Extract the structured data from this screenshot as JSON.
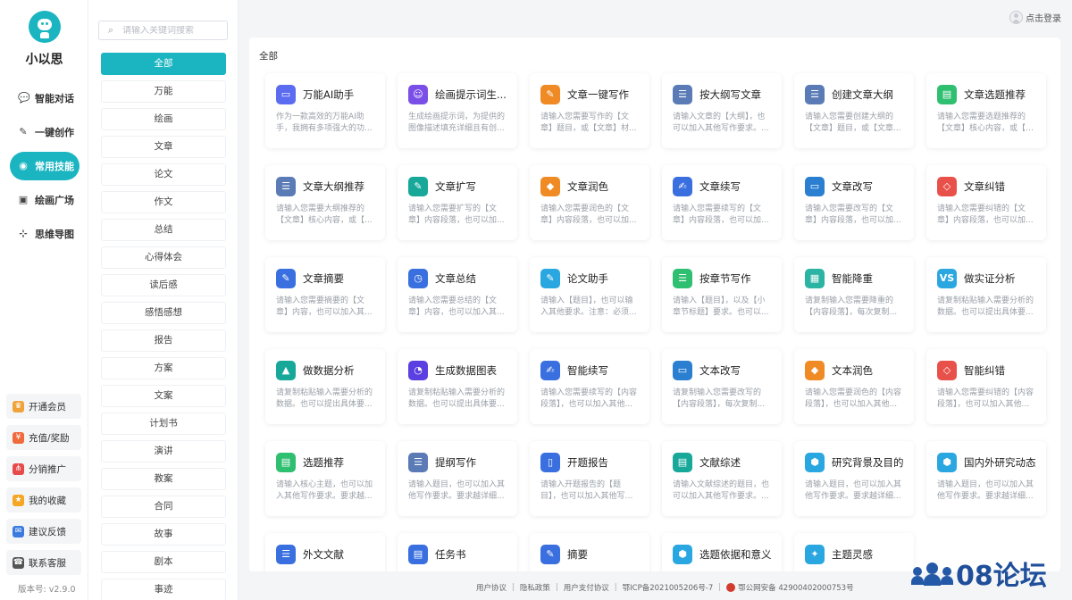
{
  "brand": {
    "name": "小以思"
  },
  "nav": [
    {
      "label": "智能对话",
      "icon": "chat-icon",
      "glyph": "💬",
      "active": false
    },
    {
      "label": "一键创作",
      "icon": "pen-icon",
      "glyph": "✎",
      "active": false
    },
    {
      "label": "常用技能",
      "icon": "skills-icon",
      "glyph": "◉",
      "active": true
    },
    {
      "label": "绘画广场",
      "icon": "image-icon",
      "glyph": "▣",
      "active": false
    },
    {
      "label": "思维导图",
      "icon": "mindmap-icon",
      "glyph": "⊹",
      "active": false
    }
  ],
  "bottom_menu": [
    {
      "label": "开通会员",
      "icon": "vip-icon",
      "glyph": "♛",
      "color": "#f0a23b"
    },
    {
      "label": "充值/奖励",
      "icon": "recharge-icon",
      "glyph": "¥",
      "color": "#f06a3b"
    },
    {
      "label": "分销推广",
      "icon": "share-icon",
      "glyph": "⋔",
      "color": "#e64a4a"
    },
    {
      "label": "我的收藏",
      "icon": "star-icon",
      "glyph": "★",
      "color": "#f5a623"
    },
    {
      "label": "建议反馈",
      "icon": "feedback-icon",
      "glyph": "✉",
      "color": "#3a7be0"
    },
    {
      "label": "联系客服",
      "icon": "service-icon",
      "glyph": "☎",
      "color": "#555555"
    }
  ],
  "version": "版本号: v2.9.0",
  "search": {
    "placeholder": "请输入关键词搜索"
  },
  "categories": [
    {
      "label": "全部",
      "active": true
    },
    {
      "label": "万能"
    },
    {
      "label": "绘画"
    },
    {
      "label": "文章"
    },
    {
      "label": "论文"
    },
    {
      "label": "作文"
    },
    {
      "label": "总结"
    },
    {
      "label": "心得体会"
    },
    {
      "label": "读后感"
    },
    {
      "label": "感悟感想"
    },
    {
      "label": "报告"
    },
    {
      "label": "方案"
    },
    {
      "label": "文案"
    },
    {
      "label": "计划书"
    },
    {
      "label": "演讲"
    },
    {
      "label": "教案"
    },
    {
      "label": "合同"
    },
    {
      "label": "故事"
    },
    {
      "label": "剧本"
    },
    {
      "label": "事迹"
    }
  ],
  "header": {
    "login_label": "点击登录"
  },
  "main": {
    "section_title": "全部"
  },
  "cards": [
    {
      "title": "万能AI助手",
      "desc": "作为一款高效的万能AI助手，我拥有多项强大的功...",
      "icon": "ai-assistant-icon",
      "glyph": "▭",
      "color": "#5b6cf0"
    },
    {
      "title": "绘画提示词生...",
      "desc": "生成绘画提示词，为提供的图像描述填充详细且有创...",
      "icon": "robot-icon",
      "glyph": "☺",
      "color": "#7a4fe8"
    },
    {
      "title": "文章一键写作",
      "desc": "请输入您需要写作的【文章】题目，或【文章】材...",
      "icon": "pencil-icon",
      "glyph": "✎",
      "color": "#f08a24"
    },
    {
      "title": "按大纲写文章",
      "desc": "请输入文章的【大纲】，也可以加入其他写作要求。...",
      "icon": "outline-icon",
      "glyph": "☰",
      "color": "#5a7bb5"
    },
    {
      "title": "创建文章大纲",
      "desc": "请输入您需要创建大纲的【文章】题目，或【文章...",
      "icon": "outline-icon",
      "glyph": "☰",
      "color": "#5a7bb5"
    },
    {
      "title": "文章选题推荐",
      "desc": "请输入您需要选题推荐的【文章】核心内容，或【文章...",
      "icon": "topic-icon",
      "glyph": "▤",
      "color": "#2fbf71"
    },
    {
      "title": "文章大纲推荐",
      "desc": "请输入您需要大纲推荐的【文章】核心内容，或【...",
      "icon": "outline-icon",
      "glyph": "☰",
      "color": "#5a7bb5"
    },
    {
      "title": "文章扩写",
      "desc": "请输入您需要扩写的【文章】内容段落，也可以加...",
      "icon": "expand-icon",
      "glyph": "✎",
      "color": "#17a89a"
    },
    {
      "title": "文章润色",
      "desc": "请输入您需要润色的【文章】内容段落，也可以加...",
      "icon": "polish-icon",
      "glyph": "◆",
      "color": "#f08a24"
    },
    {
      "title": "文章续写",
      "desc": "请输入您需要续写的【文章】内容段落，也可以加...",
      "icon": "continue-icon",
      "glyph": "✍",
      "color": "#3a6fe0"
    },
    {
      "title": "文章改写",
      "desc": "请输入您需要改写的【文章】内容段落，也可以加...",
      "icon": "rewrite-icon",
      "glyph": "▭",
      "color": "#2a7fd0"
    },
    {
      "title": "文章纠错",
      "desc": "请输入您需要纠错的【文章】内容段落，也可以加...",
      "icon": "eraser-icon",
      "glyph": "◇",
      "color": "#e8514a"
    },
    {
      "title": "文章摘要",
      "desc": "请输入您需要摘要的【文章】内容，也可以加入其...",
      "icon": "summary-icon",
      "glyph": "✎",
      "color": "#3a6fe0"
    },
    {
      "title": "文章总结",
      "desc": "请输入您需要总结的【文章】内容，也可以加入其...",
      "icon": "clock-doc-icon",
      "glyph": "◷",
      "color": "#3a6fe0"
    },
    {
      "title": "论文助手",
      "desc": "请输入【题目】，也可以输入其他要求。注意：必须...",
      "icon": "compass-icon",
      "glyph": "✎",
      "color": "#2aa7e0"
    },
    {
      "title": "按章节写作",
      "desc": "请输入【题目】，以及【小章节标题】要求。也可以...",
      "icon": "list-icon",
      "glyph": "☰",
      "color": "#2fbf71"
    },
    {
      "title": "智能降重",
      "desc": "请复制输入您需要降重的【内容段落】，每次复制...",
      "icon": "dedup-icon",
      "glyph": "▦",
      "color": "#2bb3a3"
    },
    {
      "title": "做实证分析",
      "desc": "请复制粘贴输入需要分析的数据。也可以提出具体要...",
      "icon": "vs-icon",
      "glyph": "VS",
      "color": "#2aa7e0"
    },
    {
      "title": "做数据分析",
      "desc": "请复制粘贴输入需要分析的数据。也可以提出具体要...",
      "icon": "chart-icon",
      "glyph": "▲",
      "color": "#17a89a"
    },
    {
      "title": "生成数据图表",
      "desc": "请复制粘贴输入需要分析的数据。也可以提出具体要...",
      "icon": "pie-icon",
      "glyph": "◔",
      "color": "#5b3fe0"
    },
    {
      "title": "智能续写",
      "desc": "请输入您需要续写的【内容段落】，也可以加入其他...",
      "icon": "continue-icon",
      "glyph": "✍",
      "color": "#3a6fe0"
    },
    {
      "title": "文本改写",
      "desc": "请复制输入您需要改写的【内容段落】，每次复制...",
      "icon": "rewrite-icon",
      "glyph": "▭",
      "color": "#2a7fd0"
    },
    {
      "title": "文本润色",
      "desc": "请输入您需要润色的【内容段落】，也可以加入其他...",
      "icon": "polish-icon",
      "glyph": "◆",
      "color": "#f08a24"
    },
    {
      "title": "智能纠错",
      "desc": "请输入您需要纠错的【内容段落】，也可以加入其他...",
      "icon": "eraser-icon",
      "glyph": "◇",
      "color": "#e8514a"
    },
    {
      "title": "选题推荐",
      "desc": "请输入核心主题，也可以加入其他写作要求。要求越...",
      "icon": "clipboard-icon",
      "glyph": "▤",
      "color": "#2fbf71"
    },
    {
      "title": "提纲写作",
      "desc": "请输入题目，也可以加入其他写作要求。要求越详细...",
      "icon": "outline-icon",
      "glyph": "☰",
      "color": "#5a7bb5"
    },
    {
      "title": "开题报告",
      "desc": "请输入开题报告的【题目】，也可以加入其他写作要...",
      "icon": "report-icon",
      "glyph": "▯",
      "color": "#3a6fe0"
    },
    {
      "title": "文献综述",
      "desc": "请输入文献综述的题目，也可以加入其他写作要求。...",
      "icon": "literature-icon",
      "glyph": "▤",
      "color": "#17a89a"
    },
    {
      "title": "研究背景及目的",
      "desc": "请输入题目，也可以加入其他写作要求。要求越详细...",
      "icon": "hexagon-icon",
      "glyph": "⬢",
      "color": "#2aa7e0"
    },
    {
      "title": "国内外研究动态",
      "desc": "请输入题目，也可以加入其他写作要求。要求越详细...",
      "icon": "hexagon-icon",
      "glyph": "⬢",
      "color": "#2aa7e0"
    },
    {
      "title": "外文文献",
      "desc": "",
      "icon": "foreign-doc-icon",
      "glyph": "☰",
      "color": "#3a6fe0"
    },
    {
      "title": "任务书",
      "desc": "",
      "icon": "task-icon",
      "glyph": "▤",
      "color": "#3a6fe0"
    },
    {
      "title": "摘要",
      "desc": "",
      "icon": "summary-icon",
      "glyph": "✎",
      "color": "#3a6fe0"
    },
    {
      "title": "选题依据和意义",
      "desc": "",
      "icon": "hexagon-icon",
      "glyph": "⬢",
      "color": "#2aa7e0"
    },
    {
      "title": "主题灵感",
      "desc": "",
      "icon": "bulb-icon",
      "glyph": "✦",
      "color": "#2aa7e0"
    }
  ],
  "footer": {
    "links": [
      "用户协议",
      "隐私政策",
      "用户支付协议"
    ],
    "icp": "鄂ICP备2021005206号-7",
    "police": "鄂公网安备 42900402000753号"
  },
  "watermark": {
    "text": "08论坛"
  }
}
